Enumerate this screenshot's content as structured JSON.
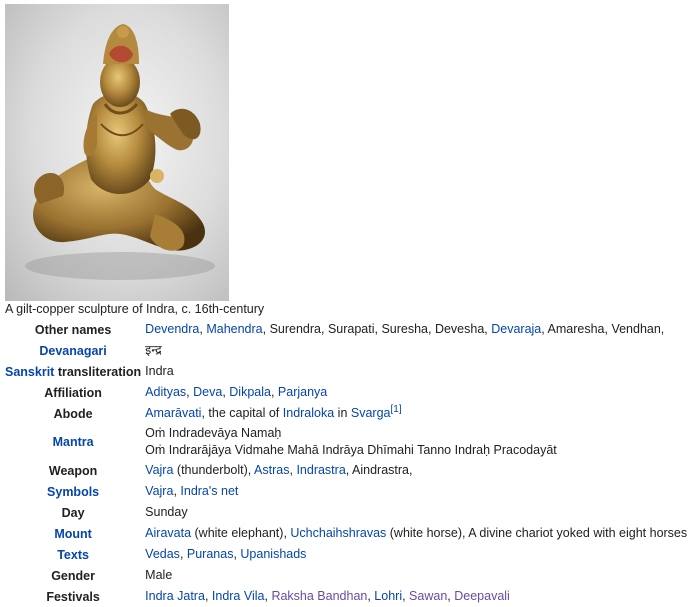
{
  "image": {
    "alt": "gilt-copper sculpture of Indra",
    "caption": "A gilt-copper sculpture of Indra, c. 16th-century"
  },
  "rows": {
    "other_names": {
      "label": "Other names",
      "links": [
        "Devendra",
        "Mahendra",
        "Devaraja"
      ],
      "t1": ", ",
      "t2": ", Surendra, Surapati, Suresha, Devesha, ",
      "t3": ", Amaresha, Vendhan,"
    },
    "devanagari": {
      "label": "Devanagari",
      "value": "इन्द्र"
    },
    "sanskrit": {
      "label_link": "Sanskrit",
      "label_rest": " transliteration",
      "value": "Indra"
    },
    "affiliation": {
      "label": "Affiliation",
      "links": [
        "Adityas",
        "Deva",
        "Dikpala",
        "Parjanya"
      ],
      "sep": ", "
    },
    "abode": {
      "label": "Abode",
      "link1": "Amarāvati",
      "t1": ", the capital of ",
      "link2": "Indraloka",
      "t2": " in ",
      "link3": "Svarga",
      "ref": "[1]"
    },
    "mantra": {
      "label": "Mantra",
      "line1": "Oṁ Indradevāya Namaḥ",
      "line2": "Oṁ Indrarājāya Vidmahe Mahā Indrāya Dhīmahi Tanno Indraḥ Pracodayāt"
    },
    "weapon": {
      "label": "Weapon",
      "link1": "Vajra",
      "t1": " (thunderbolt), ",
      "link2": "Astras",
      "t2": ", ",
      "link3": "Indrastra",
      "t3": ", Aindrastra,"
    },
    "symbols": {
      "label": "Symbols",
      "link1": "Vajra",
      "sep": ", ",
      "link2": "Indra's net"
    },
    "day": {
      "label": "Day",
      "value": "Sunday"
    },
    "mount": {
      "label": "Mount",
      "link1": "Airavata",
      "t1": " (white elephant), ",
      "link2": "Uchchaihshravas",
      "t2": " (white horse), A divine chariot yoked with eight horses"
    },
    "texts": {
      "label": "Texts",
      "links": [
        "Vedas",
        "Puranas",
        "Upanishads"
      ],
      "sep": ", "
    },
    "gender": {
      "label": "Gender",
      "value": "Male"
    },
    "festivals": {
      "label": "Festivals",
      "links": [
        "Indra Jatra",
        "Indra Vila",
        "Raksha Bandhan",
        "Lohri",
        "Sawan",
        "Deepavali"
      ],
      "sep": ", "
    }
  },
  "colors": {
    "link": "#0645ad",
    "visited_link": "#6b4ba1",
    "text": "#202122"
  }
}
